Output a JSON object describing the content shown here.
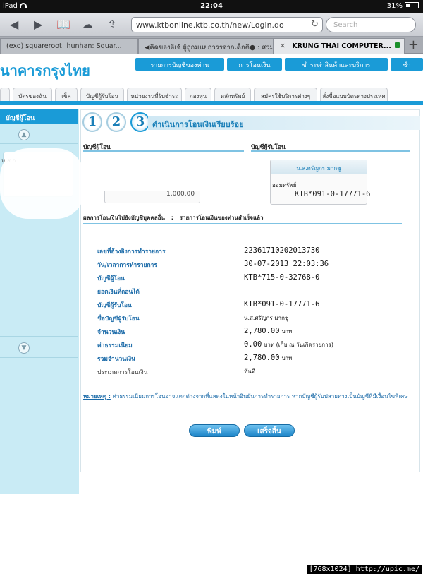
{
  "status": {
    "device": "iPad",
    "time": "22:04",
    "battery": "31%"
  },
  "browser": {
    "url": "www.ktbonline.ktb.co.th/new/Login.do",
    "search_placeholder": "Search",
    "tabs": [
      {
        "title": "(exo) squareroot! hunhan: Squar..."
      },
      {
        "title": "◀คิดของอิเจ้ ผู้ถูกมนยกวรรจากเด็กดิ● : สวม..."
      },
      {
        "title": "KRUNG THAI COMPUTER..."
      }
    ]
  },
  "site": {
    "logo": "นาคารกรุงไทย",
    "topnav": [
      "รายการบัญชีของท่าน",
      "การโอนเงิน",
      "ชำระค่าสินค้าและบริการ",
      "ชำ"
    ],
    "subtabs": [
      "",
      "บัตรของฉัน",
      "เช็ค",
      "บัญชีผู้รับโอน",
      "หน่วยงานที่รับชำระ",
      "กองทุน",
      "หลักทรัพย์",
      "สมัครใช้บริการต่างๆ",
      "สั่งซื้อแบบบัตรต่างประเทศ"
    ]
  },
  "sidebar": {
    "title": "บัญชีผู้โอน",
    "card_text": "น.ส.ก..."
  },
  "steps": {
    "numbers": [
      "1",
      "2",
      "3"
    ],
    "title": "ดำเนินการโอนเงินเรียบร้อย"
  },
  "from_section": {
    "label": "บัญชีผู้โอน",
    "amount_fragment": "1,000.00"
  },
  "to_section": {
    "label": "บัญชีผู้รับโอน",
    "name": "น.ส.ศรัญกร มากชู",
    "type": "ออมทรัพย์",
    "account": "KTB*091-0-17771-6"
  },
  "summary": {
    "prefix": "ผลการโอนเงินไปยังบัญชีบุคคลอื่น",
    "sep": ":",
    "result": "รายการโอนเงินของท่านสำเร็จแล้ว"
  },
  "details": [
    {
      "label": "เลขที่อ้างอิงการทำรายการ",
      "value": "22361710202013730"
    },
    {
      "label": "วัน/เวลาการทำรายการ",
      "value": "30-07-2013 22:03:36"
    },
    {
      "label": "บัญชีผู้โอน",
      "value": "KTB*715-0-32768-0"
    },
    {
      "label": "ยอดเงินที่ถอนได้",
      "value": ""
    },
    {
      "label": "บัญชีผู้รับโอน",
      "value": "KTB*091-0-17771-6"
    },
    {
      "label": "ชื่อบัญชีผู้รับโอน",
      "value": "น.ส.ศรัญกร มากชู"
    },
    {
      "label": "จำนวนเงิน",
      "value": "2,780.00",
      "unit": "บาท"
    },
    {
      "label": "ค่าธรรมเนียม",
      "value": "0.00",
      "unit": "บาท (เก็บ ณ วันเกิดรายการ)"
    },
    {
      "label": "รวมจำนวนเงิน",
      "value": "2,780.00",
      "unit": "บาท"
    },
    {
      "label": "ประเภทการโอนเงิน",
      "value": "ทันที"
    }
  ],
  "note": {
    "label": "หมายเหตุ :",
    "text": "ค่าธรรมเนียมการโอนอาจแตกต่างจากที่แสดงในหน้าอินยันการทำรายการ หากบัญชีผู้รับปลายทางเป็นบัญชีที่มีเงื่อนไขพิเศษ"
  },
  "buttons": {
    "print": "พิมพ์",
    "done": "เสร็จสิ้น"
  },
  "watermark": "[768x1024] http://upic.me/"
}
